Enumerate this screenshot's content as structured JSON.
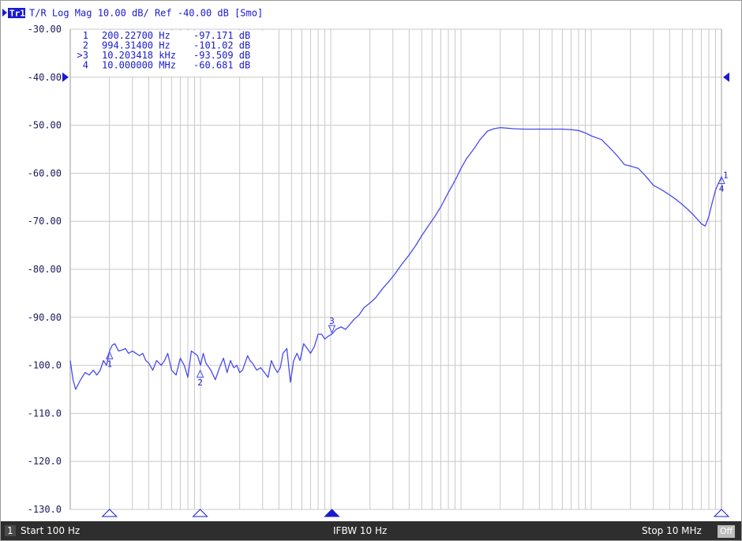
{
  "colors": {
    "trace": "#4a4af0",
    "text": "#1a1ad0",
    "grid": "#c8c8c8",
    "axis_text": "#1a1a60",
    "status_bg": "#2e2e2e"
  },
  "header": {
    "trace_label": "Tr1",
    "text": "T/R Log Mag 10.00 dB/ Ref -40.00 dB [Smo]"
  },
  "status": {
    "channel": "1",
    "start": "Start 100 Hz",
    "ifbw": "IFBW 10 Hz",
    "stop": "Stop 10 MHz",
    "toggle": "Off"
  },
  "markers_table": [
    {
      "id": "1",
      "freq": "200.22700 Hz",
      "val": "-97.171 dB"
    },
    {
      "id": "2",
      "freq": "994.31400 Hz",
      "val": "-101.02 dB"
    },
    {
      "id": ">3",
      "freq": "10.203418 kHz",
      "val": "-93.509 dB"
    },
    {
      "id": "4",
      "freq": "10.000000 MHz",
      "val": "-60.681 dB"
    }
  ],
  "chart_data": {
    "type": "line",
    "x_scale": "log",
    "xlim": [
      100,
      10000000
    ],
    "ylim": [
      -130,
      -30
    ],
    "y_ticks": [
      "-30.00",
      "-40.00",
      "-50.00",
      "-60.00",
      "-70.00",
      "-80.00",
      "-90.00",
      "-100.0",
      "-110.0",
      "-120.0",
      "-130.0"
    ],
    "ref_level": -40,
    "grid": true,
    "series": [
      {
        "x": [
          100,
          105,
          110,
          120,
          130,
          140,
          150,
          160,
          170,
          180,
          190,
          200,
          210,
          220,
          235,
          250,
          265,
          280,
          300,
          320,
          340,
          360,
          380,
          400,
          430,
          460,
          500,
          530,
          560,
          600,
          650,
          700,
          750,
          800,
          850,
          900,
          950,
          1000,
          1050,
          1100,
          1200,
          1300,
          1400,
          1500,
          1600,
          1700,
          1800,
          1900,
          2000,
          2100,
          2200,
          2300,
          2400,
          2500,
          2700,
          2900,
          3100,
          3300,
          3500,
          3700,
          3900,
          4100,
          4300,
          4600,
          4900,
          5200,
          5500,
          5800,
          6200,
          6600,
          7000,
          7500,
          8000,
          8500,
          9000,
          9500,
          10200,
          11000,
          12000,
          13000,
          14000,
          15000,
          16500,
          18000,
          20000,
          22000,
          25000,
          28000,
          31000,
          35000,
          40000,
          45000,
          50000,
          56000,
          63000,
          70000,
          80000,
          90000,
          100000,
          110000,
          125000,
          140000,
          160000,
          180000,
          200000,
          250000,
          300000,
          400000,
          500000,
          600000,
          700000,
          800000,
          900000,
          1000000,
          1200000,
          1400000,
          1600000,
          1800000,
          2000000,
          2300000,
          2600000,
          3000000,
          3500000,
          4000000,
          4500000,
          5000000,
          5500000,
          6000000,
          6500000,
          7000000,
          7500000,
          8000000,
          8500000,
          9000000,
          9500000,
          10000000
        ],
        "y": [
          -99,
          -103,
          -105,
          -103,
          -101.5,
          -102,
          -101,
          -102,
          -101,
          -99,
          -100,
          -97,
          -95.8,
          -95.5,
          -97,
          -96.8,
          -96.5,
          -97.5,
          -97,
          -97.5,
          -98,
          -97.5,
          -99,
          -99.5,
          -101,
          -99,
          -100,
          -99,
          -97.5,
          -101,
          -102,
          -98.5,
          -100,
          -102.5,
          -97,
          -97.5,
          -98,
          -100,
          -97.5,
          -99.5,
          -101,
          -103,
          -100.5,
          -98.5,
          -101.5,
          -99,
          -100.5,
          -100,
          -101.5,
          -101,
          -99.5,
          -98,
          -99,
          -99.5,
          -101,
          -100.5,
          -101.5,
          -102.5,
          -99,
          -100.5,
          -101.5,
          -100.5,
          -97.5,
          -96.5,
          -103.5,
          -99,
          -97.5,
          -99,
          -95.5,
          -96.5,
          -97.5,
          -96,
          -93.5,
          -93.5,
          -94.5,
          -94,
          -93.5,
          -92.5,
          -92,
          -92.5,
          -91.5,
          -90.5,
          -89.5,
          -88,
          -87,
          -86,
          -84,
          -82.5,
          -81,
          -79,
          -77,
          -75,
          -73,
          -71,
          -69,
          -67,
          -64,
          -61.5,
          -59,
          -57,
          -55,
          -53,
          -51.2,
          -50.7,
          -50.5,
          -50.7,
          -50.8,
          -50.8,
          -50.8,
          -50.8,
          -50.9,
          -51.1,
          -51.6,
          -52.2,
          -53,
          -54.8,
          -56.5,
          -58.2,
          -58.5,
          -59,
          -60.5,
          -62.5,
          -63.5,
          -64.5,
          -65.5,
          -66.5,
          -67.5,
          -68.5,
          -69.5,
          -70.5,
          -71,
          -69,
          -66,
          -63.5,
          -62,
          -61
        ]
      }
    ],
    "markers": [
      {
        "id": "1",
        "label": "1",
        "x": 200.227,
        "y": -97.171,
        "label_pos": "below"
      },
      {
        "id": "2",
        "label": "2",
        "x": 994.314,
        "y": -101.02,
        "label_pos": "below"
      },
      {
        "id": "3",
        "label": "3",
        "x": 10203.418,
        "y": -93.509,
        "label_pos": "above"
      },
      {
        "id": "4",
        "label": "4",
        "x": 10000000,
        "y": -60.681,
        "label_pos": "below"
      }
    ],
    "stimulus_markers_x": [
      200.227,
      994.314,
      10203.418,
      10000000
    ],
    "active_marker": "3"
  }
}
